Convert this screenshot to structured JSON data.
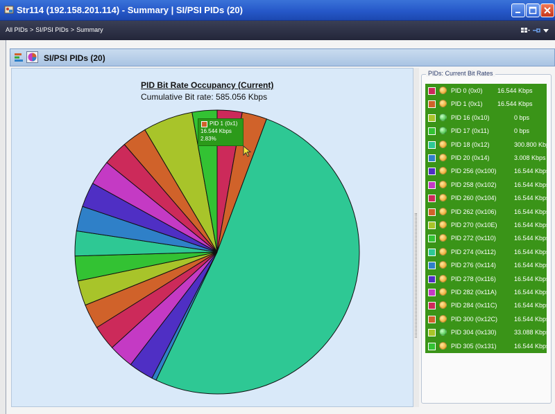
{
  "window": {
    "title": "Str114 (192.158.201.114) - Summary | SI/PSI PIDs (20)",
    "controls": [
      "minimize",
      "maximize",
      "close"
    ]
  },
  "breadcrumb": {
    "items": [
      "All PIDs",
      "SI/PSI PIDs",
      "Summary"
    ],
    "separator": ">"
  },
  "panel": {
    "title": "SI/PSI PIDs (20)"
  },
  "chart": {
    "title": "PID Bit Rate Occupancy (Current)",
    "subtitle": "Cumulative Bit rate: 585.056 Kbps"
  },
  "tooltip": {
    "line1": "PID 1 (0x1)",
    "line2": "16.544 Kbps",
    "line3": "2.83%"
  },
  "legend": {
    "caption": "PIDs: Current Bit Rates",
    "items": [
      {
        "pid": "PID 0 (0x0)",
        "rate": "16.544 Kbps",
        "color": "#cc2a5a",
        "status": "orange"
      },
      {
        "pid": "PID 1 (0x1)",
        "rate": "16.544 Kbps",
        "color": "#d0622a",
        "status": "orange"
      },
      {
        "pid": "PID 16 (0x10)",
        "rate": "0 bps",
        "color": "#a8c42a",
        "status": "green"
      },
      {
        "pid": "PID 17 (0x11)",
        "rate": "0 bps",
        "color": "#33c233",
        "status": "green"
      },
      {
        "pid": "PID 18 (0x12)",
        "rate": "300.800 Kbps",
        "color": "#2ec894",
        "status": "orange"
      },
      {
        "pid": "PID 20 (0x14)",
        "rate": "3.008 Kbps",
        "color": "#2f80c8",
        "status": "orange"
      },
      {
        "pid": "PID 256 (0x100)",
        "rate": "16.544 Kbps",
        "color": "#4f2fc4",
        "status": "orange"
      },
      {
        "pid": "PID 258 (0x102)",
        "rate": "16.544 Kbps",
        "color": "#c43ac4",
        "status": "orange"
      },
      {
        "pid": "PID 260 (0x104)",
        "rate": "16.544 Kbps",
        "color": "#cc2a5a",
        "status": "orange"
      },
      {
        "pid": "PID 262 (0x106)",
        "rate": "16.544 Kbps",
        "color": "#d0622a",
        "status": "orange"
      },
      {
        "pid": "PID 270 (0x10E)",
        "rate": "16.544 Kbps",
        "color": "#a8c42a",
        "status": "orange"
      },
      {
        "pid": "PID 272 (0x110)",
        "rate": "16.544 Kbps",
        "color": "#33c233",
        "status": "orange"
      },
      {
        "pid": "PID 274 (0x112)",
        "rate": "16.544 Kbps",
        "color": "#2ec894",
        "status": "orange"
      },
      {
        "pid": "PID 276 (0x114)",
        "rate": "16.544 Kbps",
        "color": "#2f80c8",
        "status": "orange"
      },
      {
        "pid": "PID 278 (0x116)",
        "rate": "16.544 Kbps",
        "color": "#4f2fc4",
        "status": "orange"
      },
      {
        "pid": "PID 282 (0x11A)",
        "rate": "16.544 Kbps",
        "color": "#c43ac4",
        "status": "orange"
      },
      {
        "pid": "PID 284 (0x11C)",
        "rate": "16.544 Kbps",
        "color": "#cc2a5a",
        "status": "orange"
      },
      {
        "pid": "PID 300 (0x12C)",
        "rate": "16.544 Kbps",
        "color": "#d0622a",
        "status": "orange"
      },
      {
        "pid": "PID 304 (0x130)",
        "rate": "33.088 Kbps",
        "color": "#a8c42a",
        "status": "green"
      },
      {
        "pid": "PID 305 (0x131)",
        "rate": "16.544 Kbps",
        "color": "#33c233",
        "status": "orange"
      }
    ]
  },
  "chart_data": {
    "type": "pie",
    "title": "PID Bit Rate Occupancy (Current)",
    "subtitle": "Cumulative Bit rate: 585.056 Kbps",
    "unit": "Kbps",
    "slices": [
      {
        "label": "PID 0 (0x0)",
        "value": 16.544,
        "color": "#cc2a5a"
      },
      {
        "label": "PID 1 (0x1)",
        "value": 16.544,
        "color": "#d0622a"
      },
      {
        "label": "PID 16 (0x10)",
        "value": 0,
        "color": "#a8c42a"
      },
      {
        "label": "PID 17 (0x11)",
        "value": 0,
        "color": "#33c233"
      },
      {
        "label": "PID 18 (0x12)",
        "value": 300.8,
        "color": "#2ec894"
      },
      {
        "label": "PID 20 (0x14)",
        "value": 3.008,
        "color": "#2f80c8"
      },
      {
        "label": "PID 256 (0x100)",
        "value": 16.544,
        "color": "#4f2fc4"
      },
      {
        "label": "PID 258 (0x102)",
        "value": 16.544,
        "color": "#c43ac4"
      },
      {
        "label": "PID 260 (0x104)",
        "value": 16.544,
        "color": "#cc2a5a"
      },
      {
        "label": "PID 262 (0x106)",
        "value": 16.544,
        "color": "#d0622a"
      },
      {
        "label": "PID 270 (0x10E)",
        "value": 16.544,
        "color": "#a8c42a"
      },
      {
        "label": "PID 272 (0x110)",
        "value": 16.544,
        "color": "#33c233"
      },
      {
        "label": "PID 274 (0x112)",
        "value": 16.544,
        "color": "#2ec894"
      },
      {
        "label": "PID 276 (0x114)",
        "value": 16.544,
        "color": "#2f80c8"
      },
      {
        "label": "PID 278 (0x116)",
        "value": 16.544,
        "color": "#4f2fc4"
      },
      {
        "label": "PID 282 (0x11A)",
        "value": 16.544,
        "color": "#c43ac4"
      },
      {
        "label": "PID 284 (0x11C)",
        "value": 16.544,
        "color": "#cc2a5a"
      },
      {
        "label": "PID 300 (0x12C)",
        "value": 16.544,
        "color": "#d0622a"
      },
      {
        "label": "PID 304 (0x130)",
        "value": 33.088,
        "color": "#a8c42a"
      },
      {
        "label": "PID 305 (0x131)",
        "value": 16.544,
        "color": "#33c233"
      }
    ]
  }
}
